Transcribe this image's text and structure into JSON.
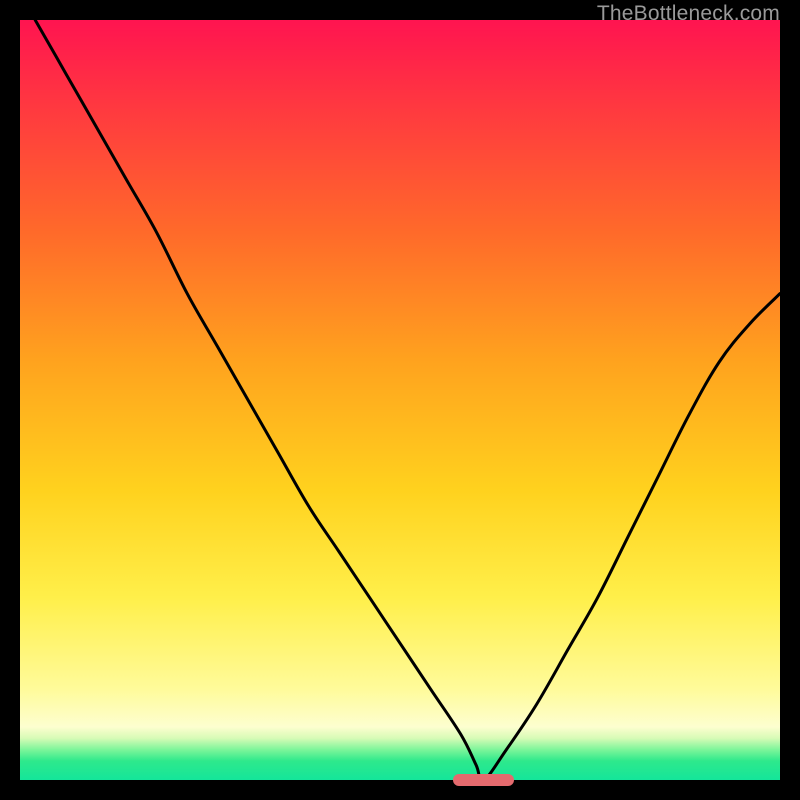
{
  "watermark": "TheBottleneck.com",
  "chart_data": {
    "type": "line",
    "title": "",
    "xlabel": "",
    "ylabel": "",
    "xlim": [
      0,
      100
    ],
    "ylim": [
      0,
      100
    ],
    "grid": false,
    "series": [
      {
        "name": "bottleneck-curve",
        "x": [
          2,
          6,
          10,
          14,
          18,
          22,
          26,
          30,
          34,
          38,
          42,
          46,
          50,
          54,
          58,
          60,
          61,
          64,
          68,
          72,
          76,
          80,
          84,
          88,
          92,
          96,
          100
        ],
        "values": [
          100,
          93,
          86,
          79,
          72,
          64,
          57,
          50,
          43,
          36,
          30,
          24,
          18,
          12,
          6,
          2,
          0,
          4,
          10,
          17,
          24,
          32,
          40,
          48,
          55,
          60,
          64
        ]
      }
    ],
    "marker": {
      "x": 61,
      "y": 0,
      "width_pct": 8,
      "height_pct": 1.6,
      "color": "#e46a6e"
    },
    "gradient_stops": [
      {
        "pos": 0,
        "color": "#ff1450"
      },
      {
        "pos": 0.12,
        "color": "#ff3a3f"
      },
      {
        "pos": 0.28,
        "color": "#ff6a2a"
      },
      {
        "pos": 0.45,
        "color": "#ffa31e"
      },
      {
        "pos": 0.62,
        "color": "#ffd21e"
      },
      {
        "pos": 0.76,
        "color": "#ffef4a"
      },
      {
        "pos": 0.88,
        "color": "#fffb9a"
      },
      {
        "pos": 0.93,
        "color": "#fdfecf"
      },
      {
        "pos": 0.945,
        "color": "#d7fbb6"
      },
      {
        "pos": 0.96,
        "color": "#7df59a"
      },
      {
        "pos": 0.975,
        "color": "#2ee98c"
      },
      {
        "pos": 1.0,
        "color": "#14e59a"
      }
    ]
  }
}
